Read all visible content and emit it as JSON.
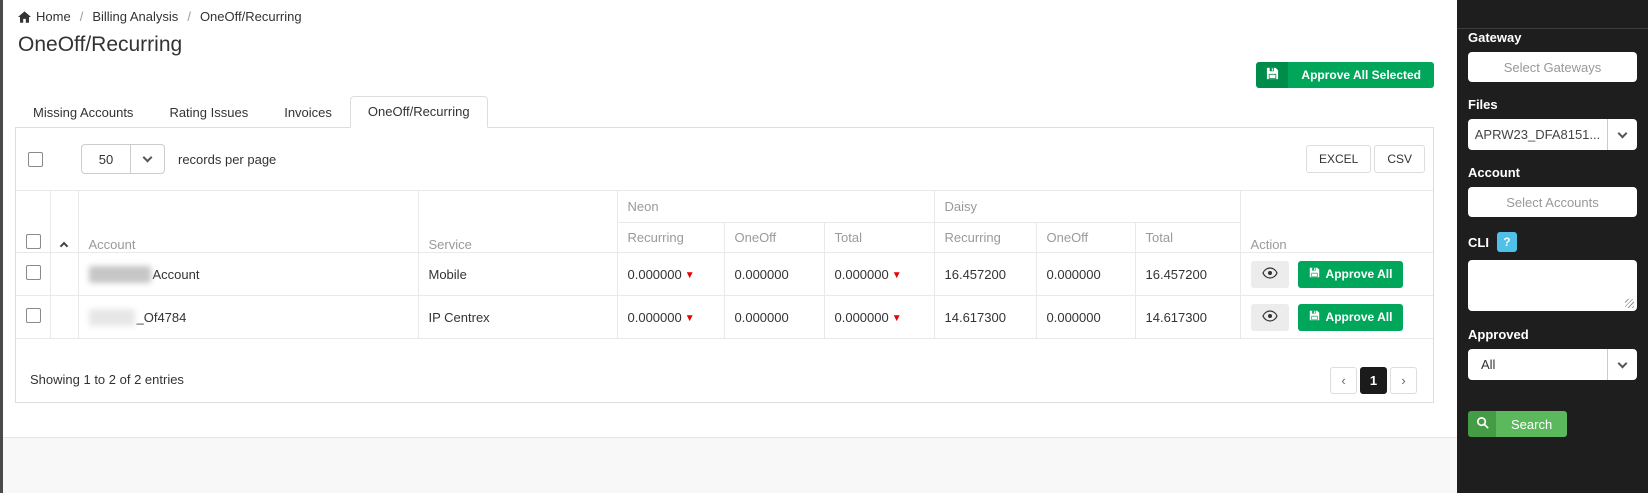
{
  "breadcrumb": {
    "home_label": "Home",
    "separator": "/",
    "items": [
      "Billing Analysis",
      "OneOff/Recurring"
    ]
  },
  "page_title": "OneOff/Recurring",
  "toolbar": {
    "approve_all_selected_label": "Approve All Selected"
  },
  "tabs": {
    "items": [
      {
        "label": "Missing Accounts",
        "active": false
      },
      {
        "label": "Rating Issues",
        "active": false
      },
      {
        "label": "Invoices",
        "active": false
      },
      {
        "label": "OneOff/Recurring",
        "active": true
      }
    ]
  },
  "list_controls": {
    "page_size": "50",
    "records_label": "records per page",
    "excel_label": "EXCEL",
    "csv_label": "CSV"
  },
  "table": {
    "groups": {
      "neon": "Neon",
      "daisy": "Daisy"
    },
    "columns": {
      "account": "Account",
      "service": "Service",
      "recurring": "Recurring",
      "oneoff": "OneOff",
      "total": "Total",
      "action": "Action"
    },
    "rows": [
      {
        "account_visible": "Account",
        "service": "Mobile",
        "neon_recurring": "0.000000",
        "neon_oneoff": "0.000000",
        "neon_total": "0.000000",
        "daisy_recurring": "16.457200",
        "daisy_oneoff": "0.000000",
        "daisy_total": "16.457200",
        "approve_label": "Approve All"
      },
      {
        "account_visible": "_Of4784",
        "service": "IP Centrex",
        "neon_recurring": "0.000000",
        "neon_oneoff": "0.000000",
        "neon_total": "0.000000",
        "daisy_recurring": "14.617300",
        "daisy_oneoff": "0.000000",
        "daisy_total": "14.617300",
        "approve_label": "Approve All"
      }
    ],
    "summary": "Showing 1 to 2 of 2 entries"
  },
  "pagination": {
    "prev": "‹",
    "page": "1",
    "next": "›"
  },
  "sidebar": {
    "gateway_label": "Gateway",
    "gateway_placeholder": "Select Gateways",
    "files_label": "Files",
    "files_value": "APRW23_DFA8151...",
    "account_label": "Account",
    "account_placeholder": "Select Accounts",
    "cli_label": "CLI",
    "cli_help": "?",
    "approved_label": "Approved",
    "approved_value": "All",
    "search_label": "Search"
  },
  "icons": {
    "down_triangle": "▼"
  },
  "colors": {
    "accent_green": "#00a65a",
    "accent_green_dark": "#008d4c",
    "search_green": "#5cb85c",
    "search_green_dark": "#449d44",
    "info_blue": "#4fc1e9",
    "flag_red": "#e60000",
    "sidebar_bg": "#1e1e1e",
    "active_page_bg": "#1b1b1b"
  }
}
